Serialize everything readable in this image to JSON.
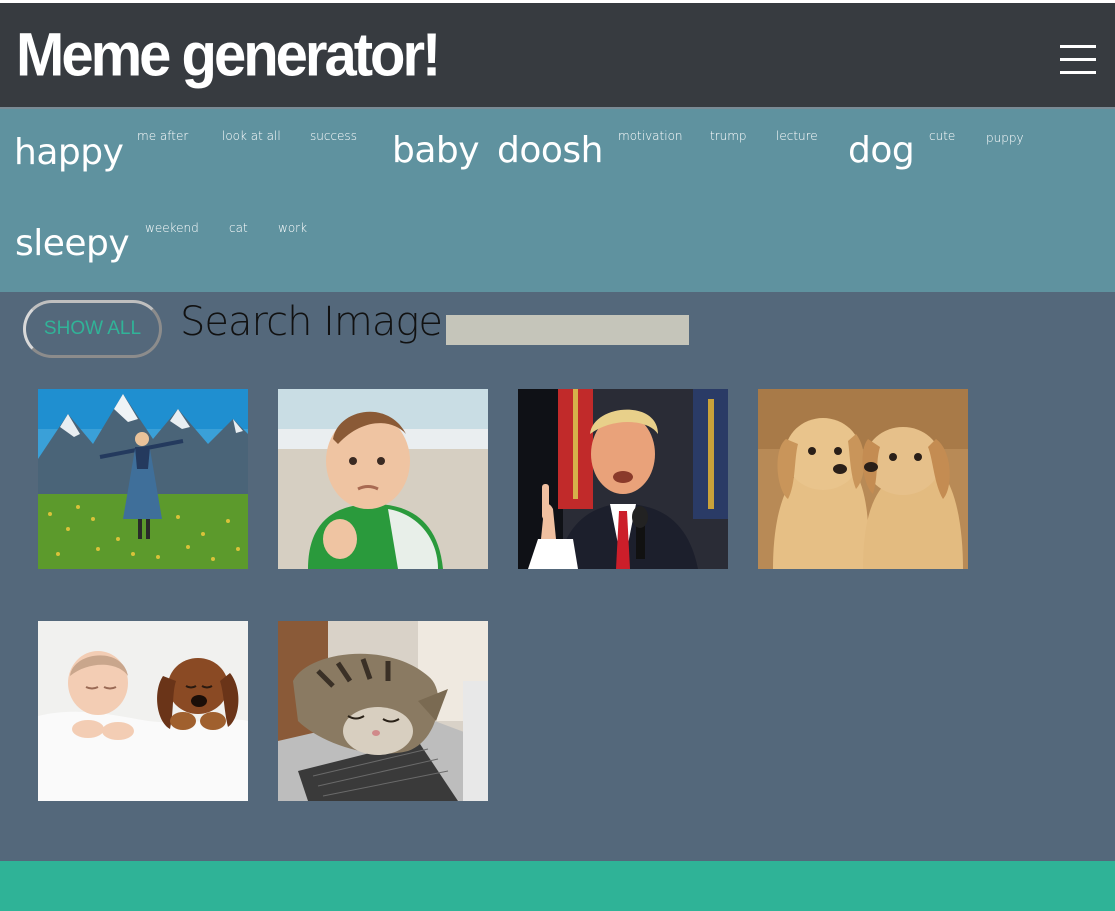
{
  "header": {
    "title": "Meme generator!",
    "menu_icon": "hamburger-menu-icon"
  },
  "tags": [
    {
      "label": "happy",
      "size": "big"
    },
    {
      "label": "me after",
      "size": "small"
    },
    {
      "label": "look at all",
      "size": "small"
    },
    {
      "label": "success",
      "size": "small"
    },
    {
      "label": "baby",
      "size": "big"
    },
    {
      "label": "doosh",
      "size": "big"
    },
    {
      "label": "motivation",
      "size": "small"
    },
    {
      "label": "trump",
      "size": "small"
    },
    {
      "label": "lecture",
      "size": "small"
    },
    {
      "label": "dog",
      "size": "big"
    },
    {
      "label": "cute",
      "size": "small"
    },
    {
      "label": "puppy",
      "size": "small"
    },
    {
      "label": "sleepy",
      "size": "big"
    },
    {
      "label": "weekend",
      "size": "small"
    },
    {
      "label": "cat",
      "size": "small"
    },
    {
      "label": "work",
      "size": "small"
    }
  ],
  "controls": {
    "show_all_label": "SHOW ALL",
    "search_label": "Search Image",
    "search_value": ""
  },
  "gallery": [
    {
      "subject": "woman in meadow with mountains"
    },
    {
      "subject": "success kid on beach"
    },
    {
      "subject": "man speaking with raised finger"
    },
    {
      "subject": "two labrador puppies"
    },
    {
      "subject": "sleeping baby and puppy"
    },
    {
      "subject": "cat sleeping on laptop"
    }
  ],
  "colors": {
    "header_bg": "#373b40",
    "tagbar_bg": "#5f929f",
    "main_bg": "#54687b",
    "footer_bg": "#2fb397",
    "accent": "#31b398"
  }
}
